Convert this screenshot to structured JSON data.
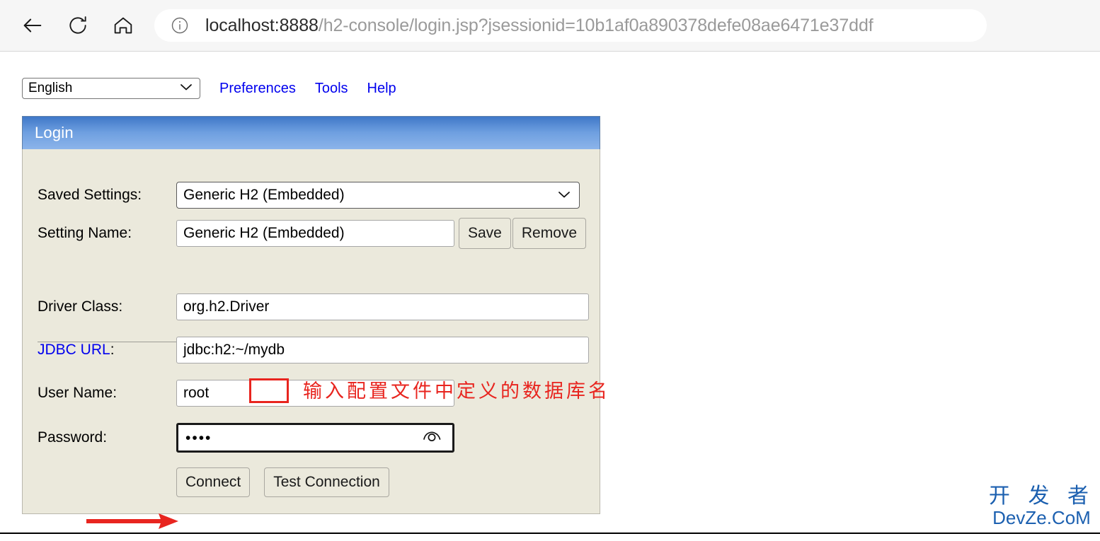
{
  "browser": {
    "back_icon": "back-arrow-icon",
    "reload_icon": "reload-icon",
    "home_icon": "home-icon",
    "info_icon": "info-icon",
    "url_host": "localhost:8888",
    "url_path": "/h2-console/login.jsp?jsessionid=10b1af0a890378defe08ae6471e37ddf",
    "url_full": "localhost:8888/h2-console/login.jsp?jsessionid=10b1af0a890378defe08ae6471e37ddf"
  },
  "toolbar": {
    "language_value": "English",
    "language_chevron_icon": "chevron-down-icon",
    "preferences_label": "Preferences",
    "tools_label": "Tools",
    "help_label": "Help",
    "link_color": "#0000ee"
  },
  "panel": {
    "title": "Login",
    "header_color_top": "#3f78c8",
    "header_color_bottom": "#8cb4ea",
    "background_color": "#ebe9dc"
  },
  "form": {
    "saved_settings": {
      "label": "Saved Settings:",
      "value": "Generic H2 (Embedded)",
      "chevron_icon": "chevron-down-icon"
    },
    "setting_name": {
      "label": "Setting Name:",
      "value": "Generic H2 (Embedded)",
      "save_label": "Save",
      "remove_label": "Remove"
    },
    "driver_class": {
      "label": "Driver Class:",
      "value": "org.h2.Driver"
    },
    "jdbc_url": {
      "label": "JDBC URL",
      "label_colon": ":",
      "value": "jdbc:h2:~/mydb",
      "label_color": "#0000ee"
    },
    "user_name": {
      "label": "User Name:",
      "value": "root"
    },
    "password": {
      "label": "Password:",
      "value": "••••",
      "reveal_icon": "eye-icon"
    },
    "connect_label": "Connect",
    "test_connection_label": "Test Connection"
  },
  "annotations": {
    "note_text": "输入配置文件中定义的数据库名",
    "note_color": "#e8251f",
    "highlight_box_target": "mydb",
    "arrow_target": "Connect"
  },
  "watermark": {
    "cn": "开 发 者",
    "en": "DevZe.CoM",
    "color": "#1c60b0"
  }
}
